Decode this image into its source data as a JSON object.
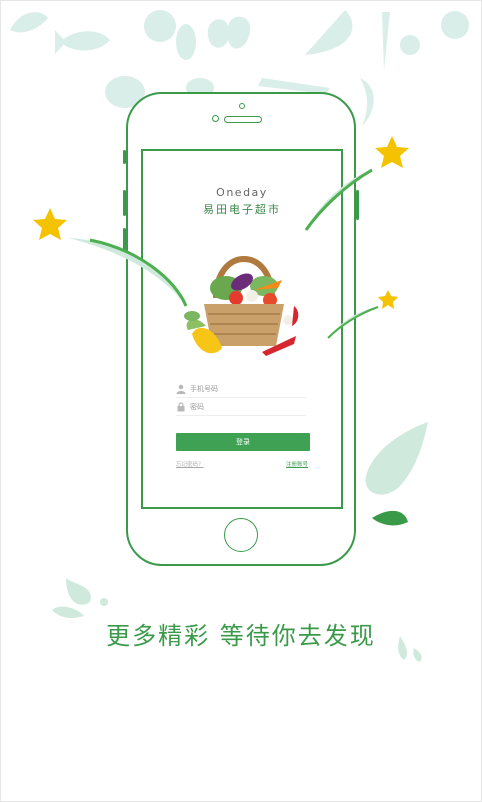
{
  "app": {
    "brand_en": "Oneday",
    "brand_cn": "易田电子超市"
  },
  "login_form": {
    "phone_placeholder": "手机号码",
    "password_placeholder": "密码",
    "login_label": "登录",
    "forgot_label": "忘记密码？",
    "register_label": "注册账号"
  },
  "tagline": "更多精彩  等待你去发现",
  "colors": {
    "accent_green": "#3a9a4a",
    "button_green": "#3fa154",
    "pale_teal": "#d6eee6",
    "star_yellow": "#f5c200"
  },
  "icons": [
    "user-icon",
    "lock-icon",
    "star-icon",
    "fish-icon",
    "apple-icon",
    "carrot-icon",
    "watermelon-icon"
  ]
}
